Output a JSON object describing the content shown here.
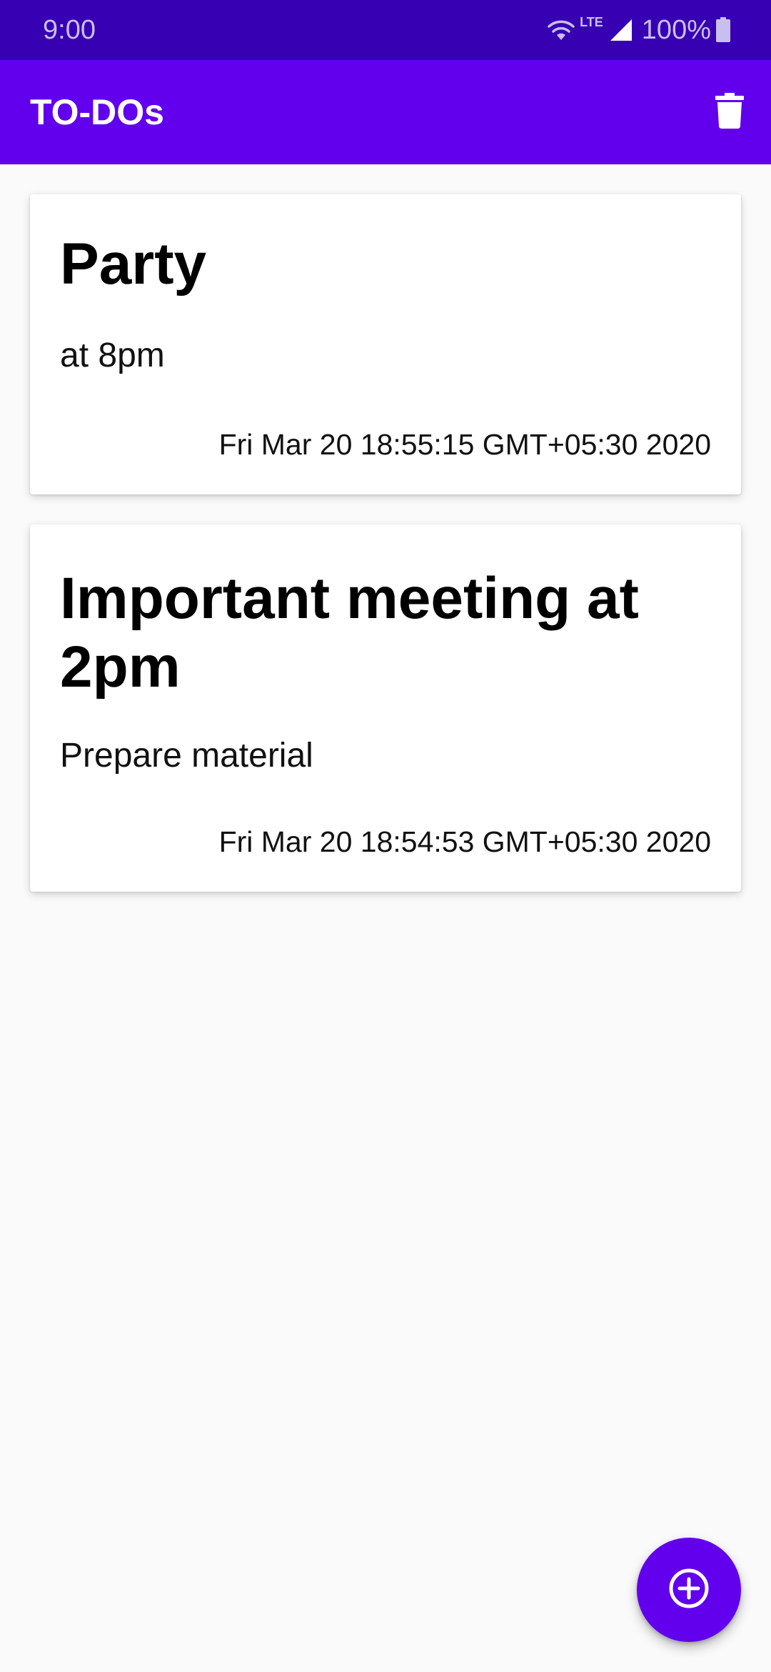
{
  "status_bar": {
    "time": "9:00",
    "network_label": "LTE",
    "battery": "100%",
    "icons": [
      "wifi-icon",
      "signal-icon",
      "battery-icon"
    ]
  },
  "app_bar": {
    "title": "TO-DOs",
    "delete_icon": "delete-icon"
  },
  "todos": [
    {
      "title": "Party",
      "description": "at 8pm",
      "date": "Fri Mar 20 18:55:15 GMT+05:30 2020"
    },
    {
      "title": "Important meeting at 2pm",
      "description": "Prepare material",
      "date": "Fri Mar 20 18:54:53 GMT+05:30 2020"
    }
  ],
  "fab": {
    "icon": "add-circle-icon"
  },
  "colors": {
    "primary": "#6200ee",
    "primary_dark": "#3700b3",
    "background": "#fafafa",
    "card": "#ffffff"
  }
}
